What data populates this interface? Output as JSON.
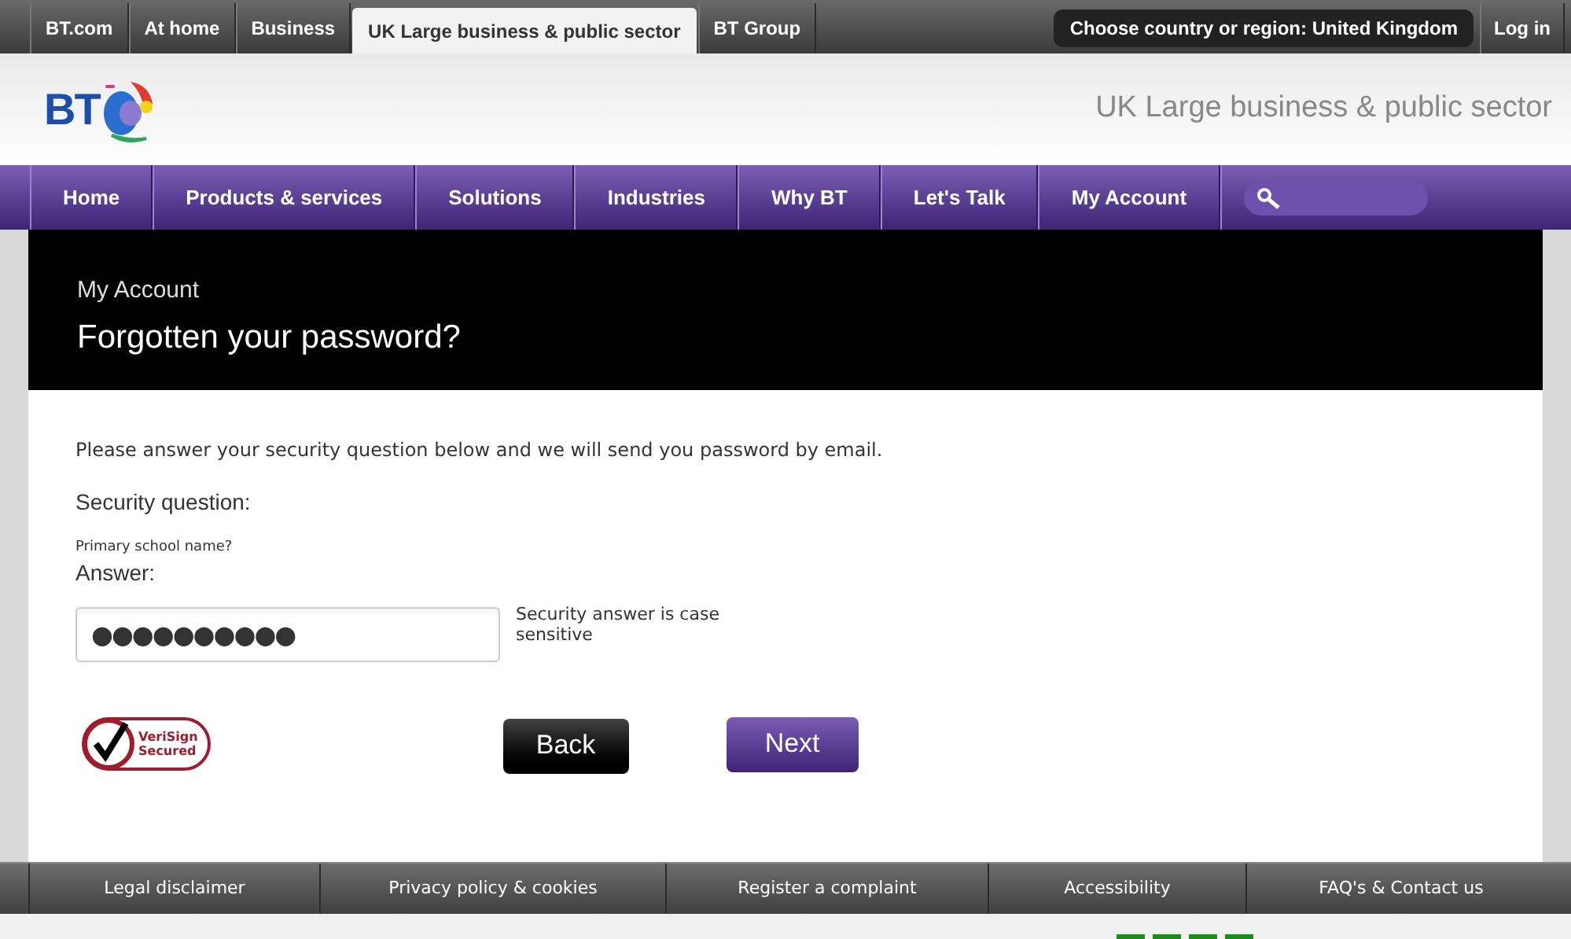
{
  "top_tabs": [
    {
      "label": "BT.com",
      "selected": false
    },
    {
      "label": "At home",
      "selected": false
    },
    {
      "label": "Business",
      "selected": false
    },
    {
      "label": "UK Large business & public sector",
      "selected": true
    },
    {
      "label": "BT Group",
      "selected": false
    }
  ],
  "region_button": "Choose country or region: United Kingdom",
  "login": "Log in",
  "logo_text": "BT",
  "header_title": "UK Large business & public sector",
  "nav": [
    "Home",
    "Products & services",
    "Solutions",
    "Industries",
    "Why BT",
    "Let's Talk",
    "My Account"
  ],
  "banner": {
    "subtitle": "My Account",
    "title": "Forgotten your password?"
  },
  "intro": "Please answer your security question below and we will send you password by email.",
  "security_question_label": "Security question:",
  "security_question": "Primary school name?",
  "answer_label": "Answer:",
  "answer_value": "●●●●●●●●●●",
  "answer_hint": "Security answer is case sensitive",
  "seal": {
    "line1": "VeriSign",
    "line2": "Secured"
  },
  "buttons": [
    {
      "label": "Back",
      "kind": "secondary"
    },
    {
      "label": "Next",
      "kind": "primary"
    }
  ],
  "footer": [
    "Legal disclaimer",
    "Privacy policy & cookies",
    "Register a complaint",
    "Accessibility",
    "FAQ's & Contact us"
  ]
}
